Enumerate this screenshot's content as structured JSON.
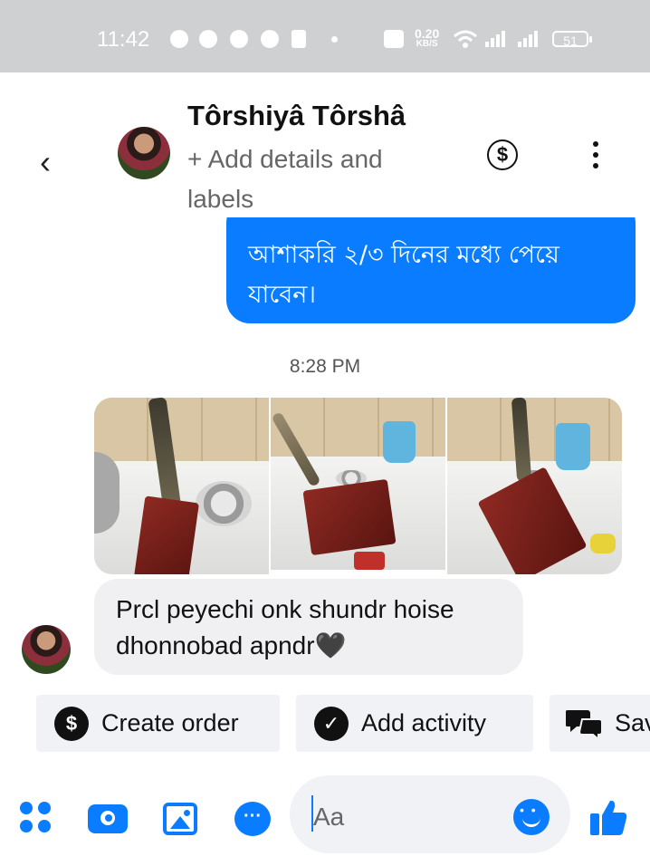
{
  "status_bar": {
    "time": "11:42",
    "net_speed": "0.20",
    "net_unit": "KB/S",
    "battery": "51"
  },
  "header": {
    "back_icon": "chevron-left-icon",
    "contact_name": "Tôrshiyâ Tôrshâ",
    "subtitle": "+ Add details and labels",
    "payment_icon": "dollar-circle-icon",
    "menu_icon": "more-vertical-icon"
  },
  "messages": {
    "outgoing_text": "আশাকরি ২/৩ দিনের মধ্যে পেয়ে যাবেন।",
    "timestamp": "8:28 PM",
    "photos_count": 3,
    "incoming_text": "Prcl peyechi onk shundr hoise dhonnobad apndr",
    "incoming_emoji": "🖤"
  },
  "quick_actions": [
    {
      "label": "Create order",
      "icon": "dollar-circle-icon"
    },
    {
      "label": "Add activity",
      "icon": "check-circle-icon"
    },
    {
      "label": "Save",
      "icon": "chat-bubbles-icon"
    }
  ],
  "composer": {
    "placeholder": "Aa",
    "icons": [
      "apps-icon",
      "camera-icon",
      "image-icon",
      "chat-icon",
      "emoji-icon",
      "thumbs-up-icon"
    ]
  },
  "colors": {
    "accent": "#0a7cff",
    "bubble_incoming": "#f0f0f3",
    "status_bar": "#cfd0d2"
  }
}
